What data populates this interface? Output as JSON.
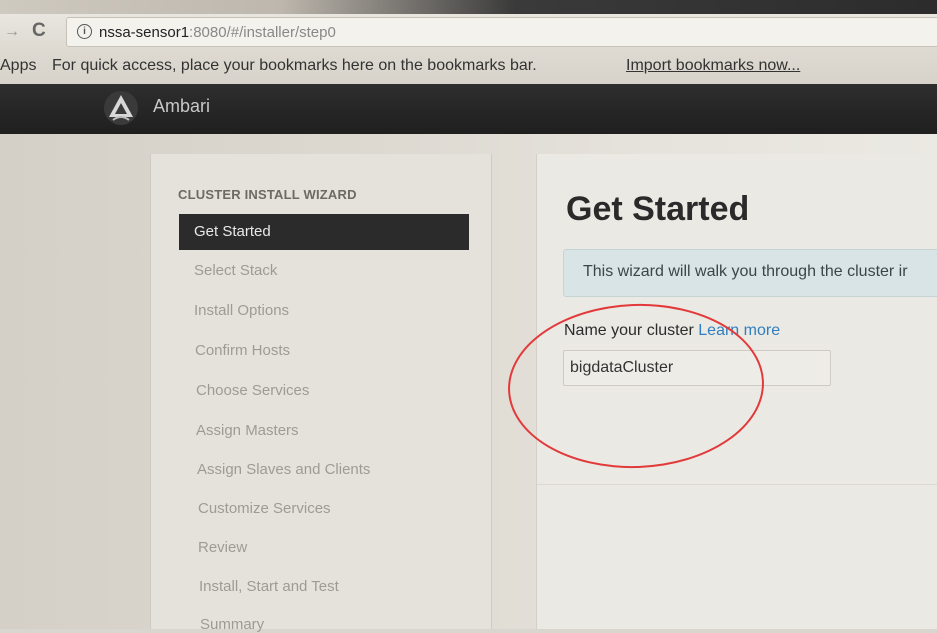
{
  "browser": {
    "url_host": "nssa-sensor1",
    "url_rest": ":8080/#/installer/step0",
    "bookmarks_apps": "Apps",
    "bookmarks_hint": "For quick access, place your bookmarks here on the bookmarks bar.",
    "bookmarks_import_link": "Import bookmarks now..."
  },
  "header": {
    "app_name": "Ambari"
  },
  "wizard": {
    "heading": "CLUSTER INSTALL WIZARD",
    "steps": [
      {
        "label": "Get Started",
        "active": true
      },
      {
        "label": "Select Stack"
      },
      {
        "label": "Install Options"
      },
      {
        "label": "Confirm Hosts"
      },
      {
        "label": "Choose Services"
      },
      {
        "label": "Assign Masters"
      },
      {
        "label": "Assign Slaves and Clients"
      },
      {
        "label": "Customize Services"
      },
      {
        "label": "Review"
      },
      {
        "label": "Install, Start and Test"
      },
      {
        "label": "Summary"
      }
    ]
  },
  "main": {
    "title": "Get Started",
    "alert_text": "This wizard will walk you through the cluster ir",
    "cluster_name_label": "Name your cluster",
    "learn_more": "Learn more",
    "cluster_name_value": "bigdataCluster"
  },
  "colors": {
    "annotation": "#e23a3a",
    "link": "#2f7fc1",
    "active_step_bg": "#2b2b2b"
  }
}
